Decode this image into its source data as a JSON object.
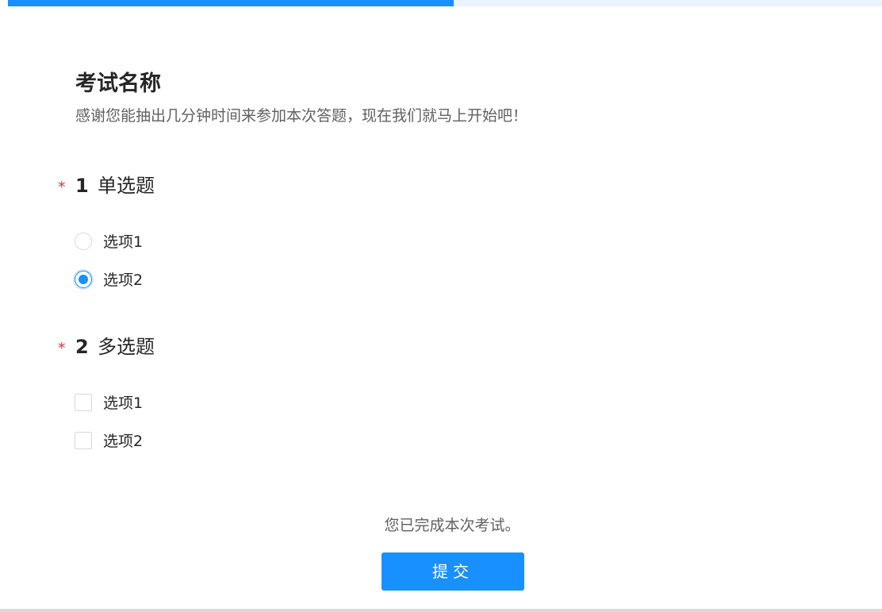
{
  "progress": {
    "percent": 51,
    "color": "#1890ff"
  },
  "exam": {
    "title": "考试名称",
    "description": "感谢您能抽出几分钟时间来参加本次答题，现在我们就马上开始吧！"
  },
  "questions": [
    {
      "required_mark": "*",
      "number": "1",
      "title": "单选题",
      "type": "radio",
      "options": [
        {
          "label": "选项1",
          "checked": false
        },
        {
          "label": "选项2",
          "checked": true
        }
      ]
    },
    {
      "required_mark": "*",
      "number": "2",
      "title": "多选题",
      "type": "checkbox",
      "options": [
        {
          "label": "选项1",
          "checked": false
        },
        {
          "label": "选项2",
          "checked": false
        }
      ]
    }
  ],
  "footer": {
    "completion_text": "您已完成本次考试。",
    "submit_label": "提交"
  },
  "colors": {
    "accent": "#1890ff",
    "required": "#d9363e"
  }
}
